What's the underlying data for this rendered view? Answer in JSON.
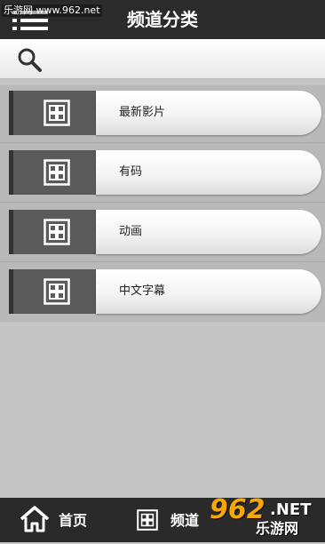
{
  "header": {
    "title": "频道分类",
    "watermark": "乐游网 www.962.net"
  },
  "search": {
    "placeholder": "",
    "value": ""
  },
  "categories": [
    {
      "label": "最新影片",
      "icon": "grid-icon"
    },
    {
      "label": "有码",
      "icon": "grid-icon"
    },
    {
      "label": "动画",
      "icon": "grid-icon"
    },
    {
      "label": "中文字幕",
      "icon": "grid-icon"
    }
  ],
  "bottom_nav": {
    "items": [
      {
        "label": "首页",
        "icon": "home-icon"
      },
      {
        "label": "频道",
        "icon": "grid-icon"
      }
    ]
  },
  "logo": {
    "number": "962",
    "suffix": ".NET",
    "cn": "乐游网"
  },
  "colors": {
    "header_bg": "#2b2b2b",
    "icon_box_bg": "#5a5a5a",
    "page_bg": "#c4c4c4",
    "logo_accent": "#f6a800"
  }
}
